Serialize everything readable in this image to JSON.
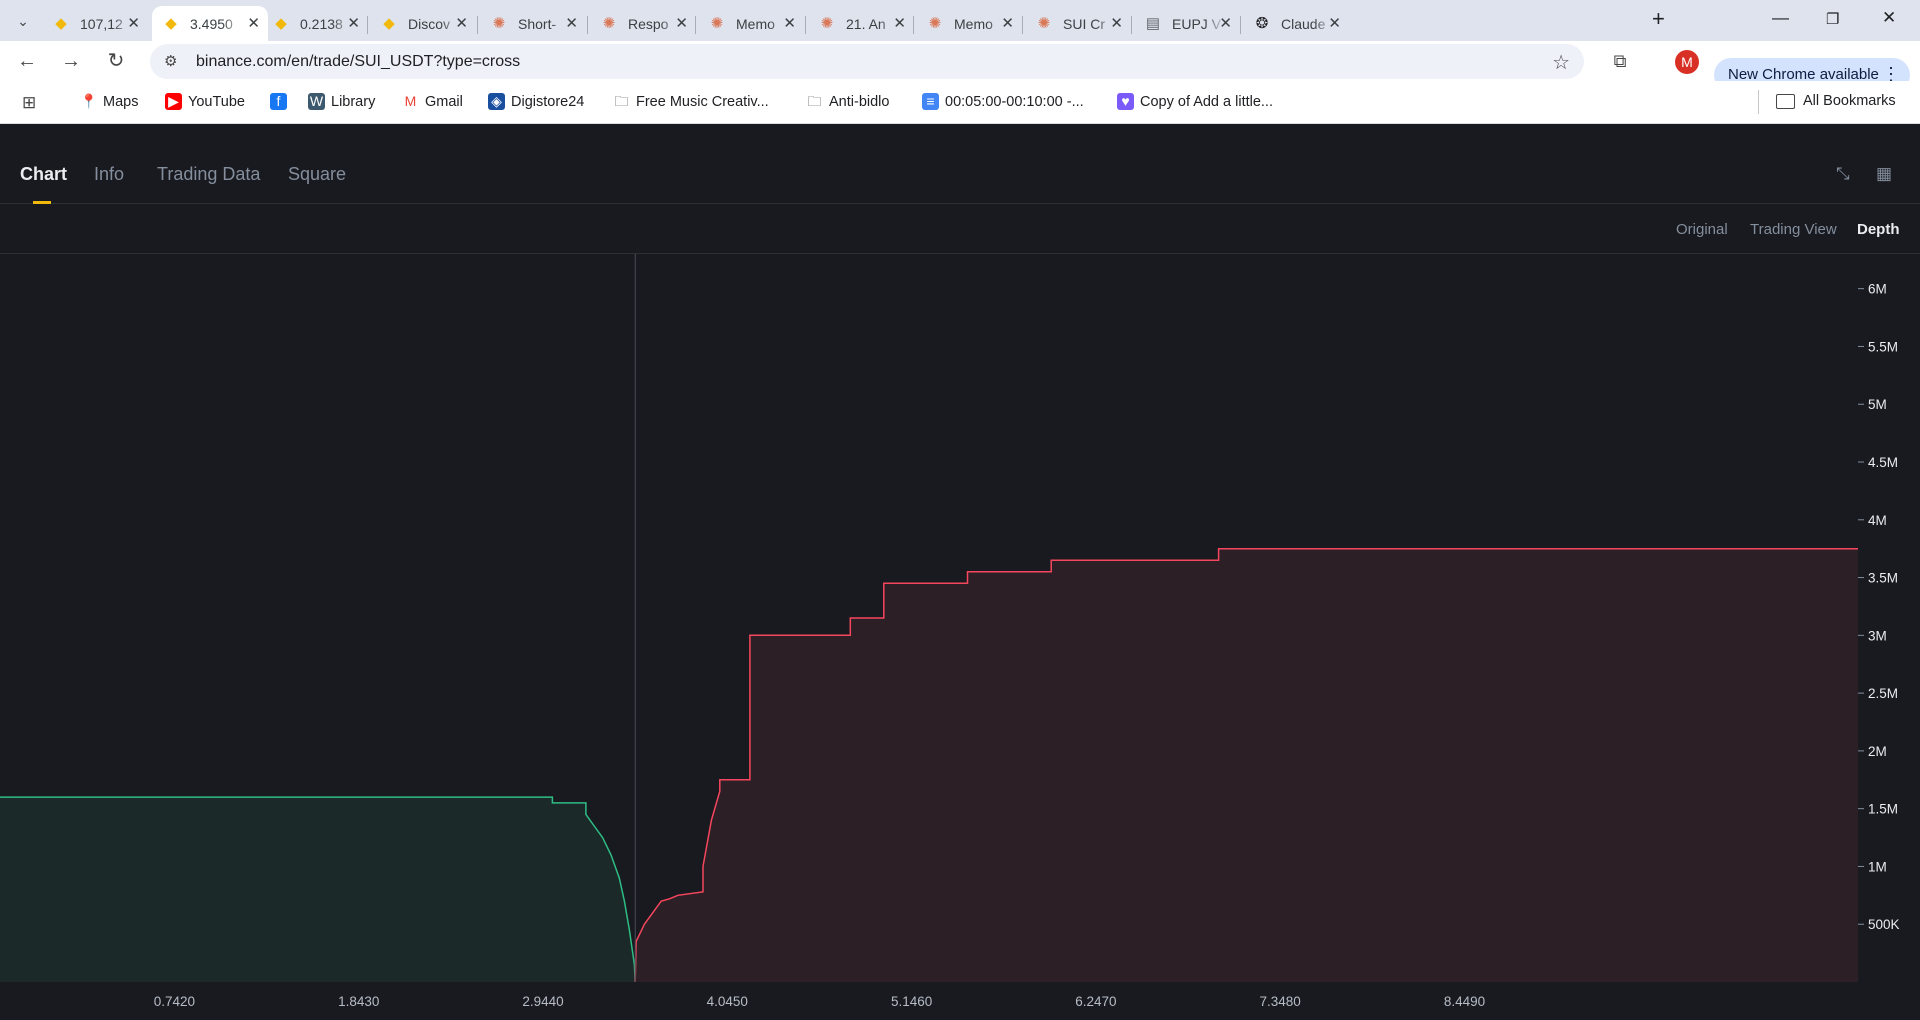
{
  "browser": {
    "tabs": [
      {
        "title": "107,12",
        "icon": "binance-icon"
      },
      {
        "title": "3.4950",
        "icon": "binance-icon",
        "active": true
      },
      {
        "title": "0.2138",
        "icon": "binance-icon"
      },
      {
        "title": "Discov",
        "icon": "binance-icon"
      },
      {
        "title": "Short-",
        "icon": "claude-icon"
      },
      {
        "title": "Respo",
        "icon": "claude-icon"
      },
      {
        "title": "Memo",
        "icon": "claude-icon"
      },
      {
        "title": "21. An",
        "icon": "claude-icon"
      },
      {
        "title": "Memo",
        "icon": "claude-icon"
      },
      {
        "title": "SUI Cr",
        "icon": "claude-icon"
      },
      {
        "title": "EUPJ V",
        "icon": "document-icon"
      },
      {
        "title": "Claude",
        "icon": "openai-icon"
      }
    ],
    "url": "binance.com/en/trade/SUI_USDT?type=cross",
    "profile_initial": "M",
    "update_label": "New Chrome available",
    "bookmarks": [
      {
        "label": "Maps",
        "icon": "maps-icon"
      },
      {
        "label": "YouTube",
        "icon": "youtube-icon"
      },
      {
        "label": "",
        "icon": "facebook-icon"
      },
      {
        "label": "Library",
        "icon": "wordpress-icon"
      },
      {
        "label": "Gmail",
        "icon": "gmail-icon"
      },
      {
        "label": "Digistore24",
        "icon": "digistore-icon"
      },
      {
        "label": "Free Music Creativ...",
        "icon": "folder-icon"
      },
      {
        "label": "Anti-bidlo",
        "icon": "folder-icon"
      },
      {
        "label": "00:05:00-00:10:00 -...",
        "icon": "docs-icon"
      },
      {
        "label": "Copy of Add a little...",
        "icon": "heart-chat-icon"
      }
    ],
    "all_bookmarks_label": "All Bookmarks"
  },
  "page": {
    "tabs": [
      "Chart",
      "Info",
      "Trading Data",
      "Square"
    ],
    "active_tab": "Chart",
    "modes": [
      "Original",
      "Trading View",
      "Depth"
    ],
    "active_mode": "Depth"
  },
  "colors": {
    "bid_line": "#2ebd85",
    "bid_fill": "#1b2a28",
    "ask_line": "#f6465d",
    "ask_fill": "#2d1f26",
    "accent": "#f0b90b"
  },
  "chart_data": {
    "type": "area",
    "title": "",
    "xlabel": "",
    "ylabel": "",
    "x_ticks": [
      "0.7420",
      "1.8430",
      "2.9440",
      "4.0450",
      "5.1460",
      "6.2470",
      "7.3480",
      "8.4490"
    ],
    "y_ticks": [
      "6M",
      "5.5M",
      "5M",
      "4.5M",
      "4M",
      "3.5M",
      "3M",
      "2.5M",
      "2M",
      "1.5M",
      "1M",
      "500K"
    ],
    "xlim": [
      -0.3,
      10.8
    ],
    "ylim": [
      0,
      6300000
    ],
    "mid_price": 3.495,
    "series": [
      {
        "side": "bids",
        "points": [
          [
            -0.3,
            1600000
          ],
          [
            3.0,
            1600000
          ],
          [
            3.0,
            1550000
          ],
          [
            3.2,
            1550000
          ],
          [
            3.2,
            1450000
          ],
          [
            3.25,
            1350000
          ],
          [
            3.3,
            1250000
          ],
          [
            3.35,
            1100000
          ],
          [
            3.4,
            900000
          ],
          [
            3.43,
            700000
          ],
          [
            3.46,
            450000
          ],
          [
            3.49,
            150000
          ],
          [
            3.495,
            0
          ]
        ]
      },
      {
        "side": "asks",
        "points": [
          [
            3.495,
            0
          ],
          [
            3.5,
            350000
          ],
          [
            3.55,
            500000
          ],
          [
            3.6,
            600000
          ],
          [
            3.65,
            700000
          ],
          [
            3.7,
            720000
          ],
          [
            3.75,
            750000
          ],
          [
            3.9,
            780000
          ],
          [
            3.9,
            1000000
          ],
          [
            3.95,
            1400000
          ],
          [
            4.0,
            1650000
          ],
          [
            4.0,
            1750000
          ],
          [
            4.18,
            1750000
          ],
          [
            4.18,
            3000000
          ],
          [
            4.78,
            3000000
          ],
          [
            4.78,
            3150000
          ],
          [
            4.98,
            3150000
          ],
          [
            4.98,
            3450000
          ],
          [
            5.48,
            3450000
          ],
          [
            5.48,
            3550000
          ],
          [
            5.98,
            3550000
          ],
          [
            5.98,
            3650000
          ],
          [
            6.98,
            3650000
          ],
          [
            6.98,
            3750000
          ],
          [
            10.8,
            3750000
          ]
        ]
      }
    ]
  }
}
